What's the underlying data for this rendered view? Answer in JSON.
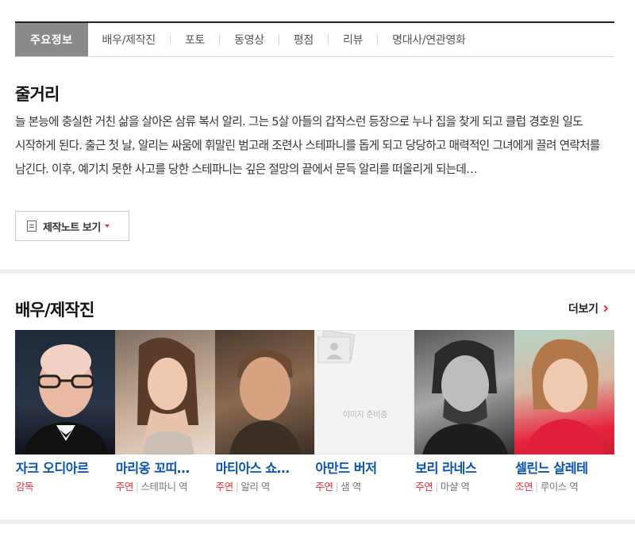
{
  "tabs": [
    {
      "label": "주요정보",
      "active": true
    },
    {
      "label": "배우/제작진",
      "active": false
    },
    {
      "label": "포토",
      "active": false
    },
    {
      "label": "동영상",
      "active": false
    },
    {
      "label": "평점",
      "active": false
    },
    {
      "label": "리뷰",
      "active": false
    },
    {
      "label": "명대사/연관영화",
      "active": false
    }
  ],
  "synopsis": {
    "title": "줄거리",
    "text": "늘 본능에 충실한 거친 삶을 살아온 삼류 복서 알리. 그는 5살 아들의 갑작스런 등장으로 누나 집을 찾게 되고 클럽 경호원 일도 시작하게 된다. 출근 첫 날, 알리는 싸움에 휘말린 범고래 조련사 스테파니를 돕게 되고 당당하고 매력적인 그녀에게 끌려 연락처를 남긴다. 이후, 예기치 못한 사고를 당한 스테파니는 깊은 절망의 끝에서 문득 알리를 떠올리게 되는데…",
    "note_button": "제작노트 보기"
  },
  "cast_section": {
    "title": "배우/제작진",
    "more": "더보기",
    "placeholder_text": "이미지 준비중",
    "members": [
      {
        "name": "자크 오디아르",
        "kind": "감독",
        "character": ""
      },
      {
        "name": "마리옹 꼬띠…",
        "kind": "주연",
        "character": "스테파니 역"
      },
      {
        "name": "마티아스 쇼…",
        "kind": "주연",
        "character": "알리 역"
      },
      {
        "name": "아만드 버저",
        "kind": "주연",
        "character": "샘 역"
      },
      {
        "name": "보리 라네스",
        "kind": "주연",
        "character": "마샬 역"
      },
      {
        "name": "셀린느 살레테",
        "kind": "조연",
        "character": "루이스 역"
      }
    ]
  },
  "colors": {
    "active_tab": "#8a8a8a",
    "link_blue": "#0a53a8",
    "accent_red": "#e8323c"
  }
}
